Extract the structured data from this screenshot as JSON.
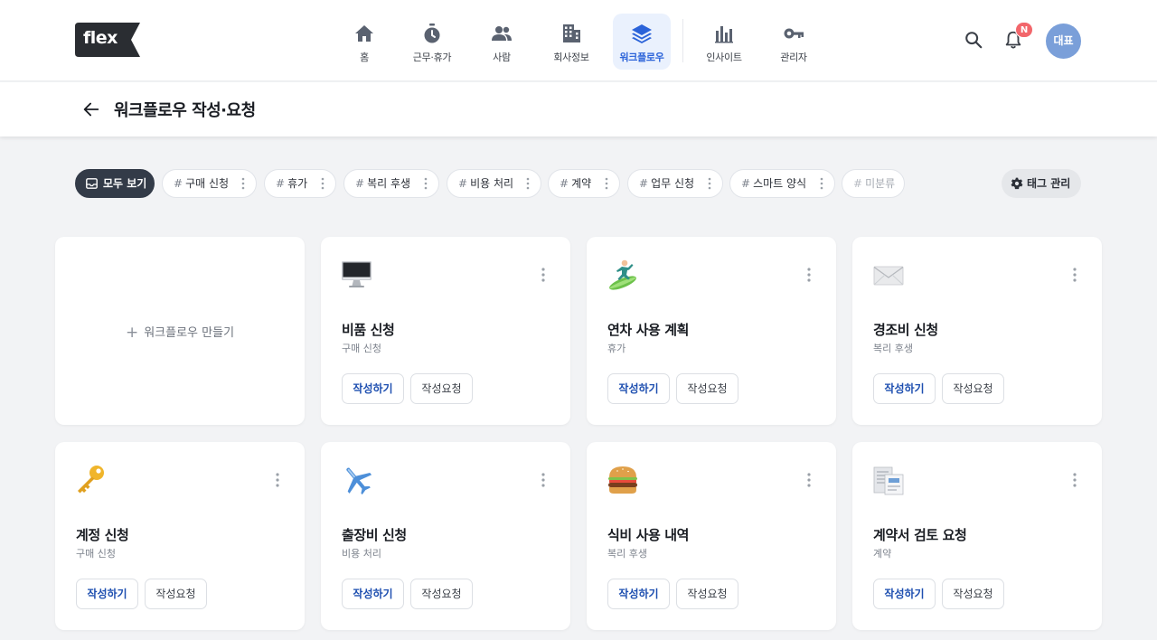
{
  "brand": {
    "logo_text": "flex"
  },
  "nav": {
    "items": [
      {
        "label": "홈",
        "icon": "home-icon"
      },
      {
        "label": "근무·휴가",
        "icon": "stopwatch-icon"
      },
      {
        "label": "사람",
        "icon": "people-icon"
      },
      {
        "label": "회사정보",
        "icon": "building-icon"
      },
      {
        "label": "워크플로우",
        "icon": "layers-icon",
        "active": true
      },
      {
        "label": "인사이트",
        "icon": "bar-chart-icon"
      },
      {
        "label": "관리자",
        "icon": "key-icon"
      }
    ],
    "notification_badge": "N",
    "avatar_label": "대표"
  },
  "header": {
    "title": "워크플로우 작성·요청"
  },
  "tags": {
    "all_label": "모두 보기",
    "items": [
      {
        "label": "구매 신청"
      },
      {
        "label": "휴가"
      },
      {
        "label": "복리 후생"
      },
      {
        "label": "비용 처리"
      },
      {
        "label": "계약"
      },
      {
        "label": "업무 신청"
      },
      {
        "label": "스마트 양식"
      },
      {
        "label": "미분류"
      }
    ],
    "hash": "#",
    "manage_label": "태그 관리"
  },
  "create_card": {
    "plus": "+",
    "label": "워크플로우 만들기"
  },
  "buttons": {
    "write": "작성하기",
    "request": "작성요청"
  },
  "cards": [
    {
      "title": "비품 신청",
      "category": "구매 신청",
      "icon": "computer-icon"
    },
    {
      "title": "연차 사용 계획",
      "category": "휴가",
      "icon": "surfer-icon"
    },
    {
      "title": "경조비 신청",
      "category": "복리 후생",
      "icon": "envelope-icon"
    },
    {
      "title": "계정 신청",
      "category": "구매 신청",
      "icon": "key-icon"
    },
    {
      "title": "출장비 신청",
      "category": "비용 처리",
      "icon": "airplane-icon"
    },
    {
      "title": "식비 사용 내역",
      "category": "복리 후생",
      "icon": "burger-icon"
    },
    {
      "title": "계약서 검토 요청",
      "category": "계약",
      "icon": "document-icon"
    }
  ]
}
